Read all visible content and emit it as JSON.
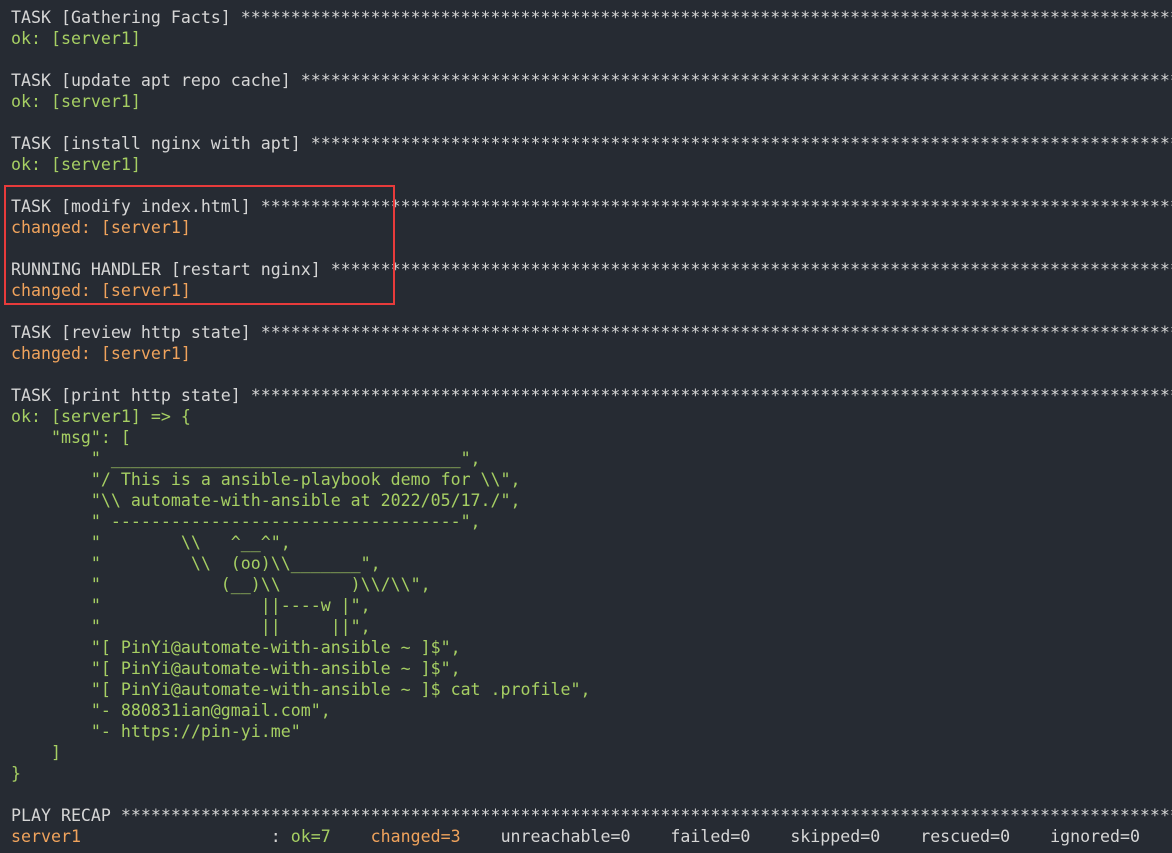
{
  "colors": {
    "background": "#262b33",
    "default_text": "#d6d6d6",
    "ok_text": "#a6cf63",
    "changed_text": "#f0a35c",
    "highlight_border": "#e83b3b"
  },
  "output": [
    {
      "text": "TASK [Gathering Facts] **************************************************************************************************************************************",
      "style": "default"
    },
    {
      "text": "ok: [server1]",
      "style": "ok"
    },
    {
      "text": "",
      "style": "default"
    },
    {
      "text": "TASK [update apt repo cache] ********************************************************************************************************************************",
      "style": "default"
    },
    {
      "text": "ok: [server1]",
      "style": "ok"
    },
    {
      "text": "",
      "style": "default"
    },
    {
      "text": "TASK [install nginx with apt] *******************************************************************************************************************************",
      "style": "default"
    },
    {
      "text": "ok: [server1]",
      "style": "ok"
    },
    {
      "text": "",
      "style": "default"
    },
    {
      "text": "TASK [modify index.html] ************************************************************************************************************************************",
      "style": "default"
    },
    {
      "text": "changed: [server1]",
      "style": "changed"
    },
    {
      "text": "",
      "style": "default"
    },
    {
      "text": "RUNNING HANDLER [restart nginx] *****************************************************************************************************************************",
      "style": "default"
    },
    {
      "text": "changed: [server1]",
      "style": "changed"
    },
    {
      "text": "",
      "style": "default"
    },
    {
      "text": "TASK [review http state] ************************************************************************************************************************************",
      "style": "default"
    },
    {
      "text": "changed: [server1]",
      "style": "changed"
    },
    {
      "text": "",
      "style": "default"
    },
    {
      "text": "TASK [print http state] *************************************************************************************************************************************",
      "style": "default"
    },
    {
      "text": "ok: [server1] => {",
      "style": "ok"
    },
    {
      "text": "    \"msg\": [",
      "style": "ok"
    },
    {
      "text": "        \" ___________________________________\",",
      "style": "ok"
    },
    {
      "text": "        \"/ This is a ansible-playbook demo for \\\\\",",
      "style": "ok"
    },
    {
      "text": "        \"\\\\ automate-with-ansible at 2022/05/17./\",",
      "style": "ok"
    },
    {
      "text": "        \" -----------------------------------\",",
      "style": "ok"
    },
    {
      "text": "        \"        \\\\   ^__^\",",
      "style": "ok"
    },
    {
      "text": "        \"         \\\\  (oo)\\\\_______\",",
      "style": "ok"
    },
    {
      "text": "        \"            (__)\\\\       )\\\\/\\\\\",",
      "style": "ok"
    },
    {
      "text": "        \"                ||----w |\",",
      "style": "ok"
    },
    {
      "text": "        \"                ||     ||\",",
      "style": "ok"
    },
    {
      "text": "        \"[ PinYi@automate-with-ansible ~ ]$\",",
      "style": "ok"
    },
    {
      "text": "        \"[ PinYi@automate-with-ansible ~ ]$\",",
      "style": "ok"
    },
    {
      "text": "        \"[ PinYi@automate-with-ansible ~ ]$ cat .profile\",",
      "style": "ok"
    },
    {
      "text": "        \"- 880831ian@gmail.com\",",
      "style": "ok"
    },
    {
      "text": "        \"- https://pin-yi.me\"",
      "style": "ok"
    },
    {
      "text": "    ]",
      "style": "ok"
    },
    {
      "text": "}",
      "style": "ok"
    },
    {
      "text": "",
      "style": "default"
    },
    {
      "text": "PLAY RECAP **********************************************************************************************************************************************",
      "style": "default"
    }
  ],
  "recap": {
    "host": "server1",
    "separator": "                   : ",
    "ok": "ok=7",
    "gap1": "    ",
    "changed": "changed=3",
    "gap2": "    ",
    "unreachable": "unreachable=0",
    "gap3": "    ",
    "failed": "failed=0",
    "gap4": "    ",
    "skipped": "skipped=0",
    "gap5": "    ",
    "rescued": "rescued=0",
    "gap6": "    ",
    "ignored": "ignored=0"
  }
}
